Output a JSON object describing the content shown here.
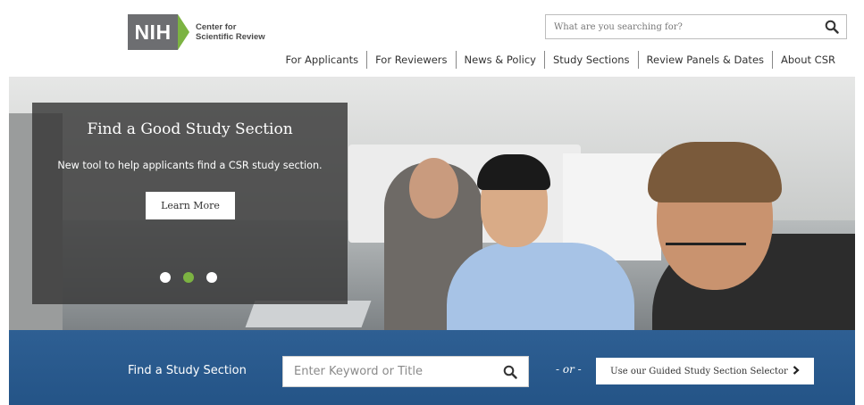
{
  "header": {
    "logo": {
      "mark": "NIH",
      "line1": "Center for",
      "line2": "Scientific Review"
    },
    "search": {
      "placeholder": "What are you searching for?",
      "icon": "search-icon"
    },
    "nav": [
      {
        "label": "For Applicants"
      },
      {
        "label": "For Reviewers"
      },
      {
        "label": "News & Policy"
      },
      {
        "label": "Study Sections"
      },
      {
        "label": "Review Panels & Dates"
      },
      {
        "label": "About CSR"
      }
    ]
  },
  "hero": {
    "title": "Find a Good Study Section",
    "subtitle": "New tool to help applicants find a CSR study section.",
    "button_label": "Learn More",
    "slides": {
      "count": 3,
      "active_index": 1
    },
    "colors": {
      "overlay": "#373737",
      "dot_active": "#7cb342",
      "dot_inactive": "#ffffff"
    }
  },
  "finder": {
    "label": "Find a Study Section",
    "search_placeholder": "Enter Keyword or Title",
    "or_text": "- or -",
    "guided_label": "Use our Guided Study Section Selector",
    "guided_icon": "chevron-right-icon",
    "colors": {
      "band": "#2b5b8f"
    }
  },
  "colors": {
    "nih_gray": "#6d6e71",
    "nih_green": "#7cb342"
  }
}
